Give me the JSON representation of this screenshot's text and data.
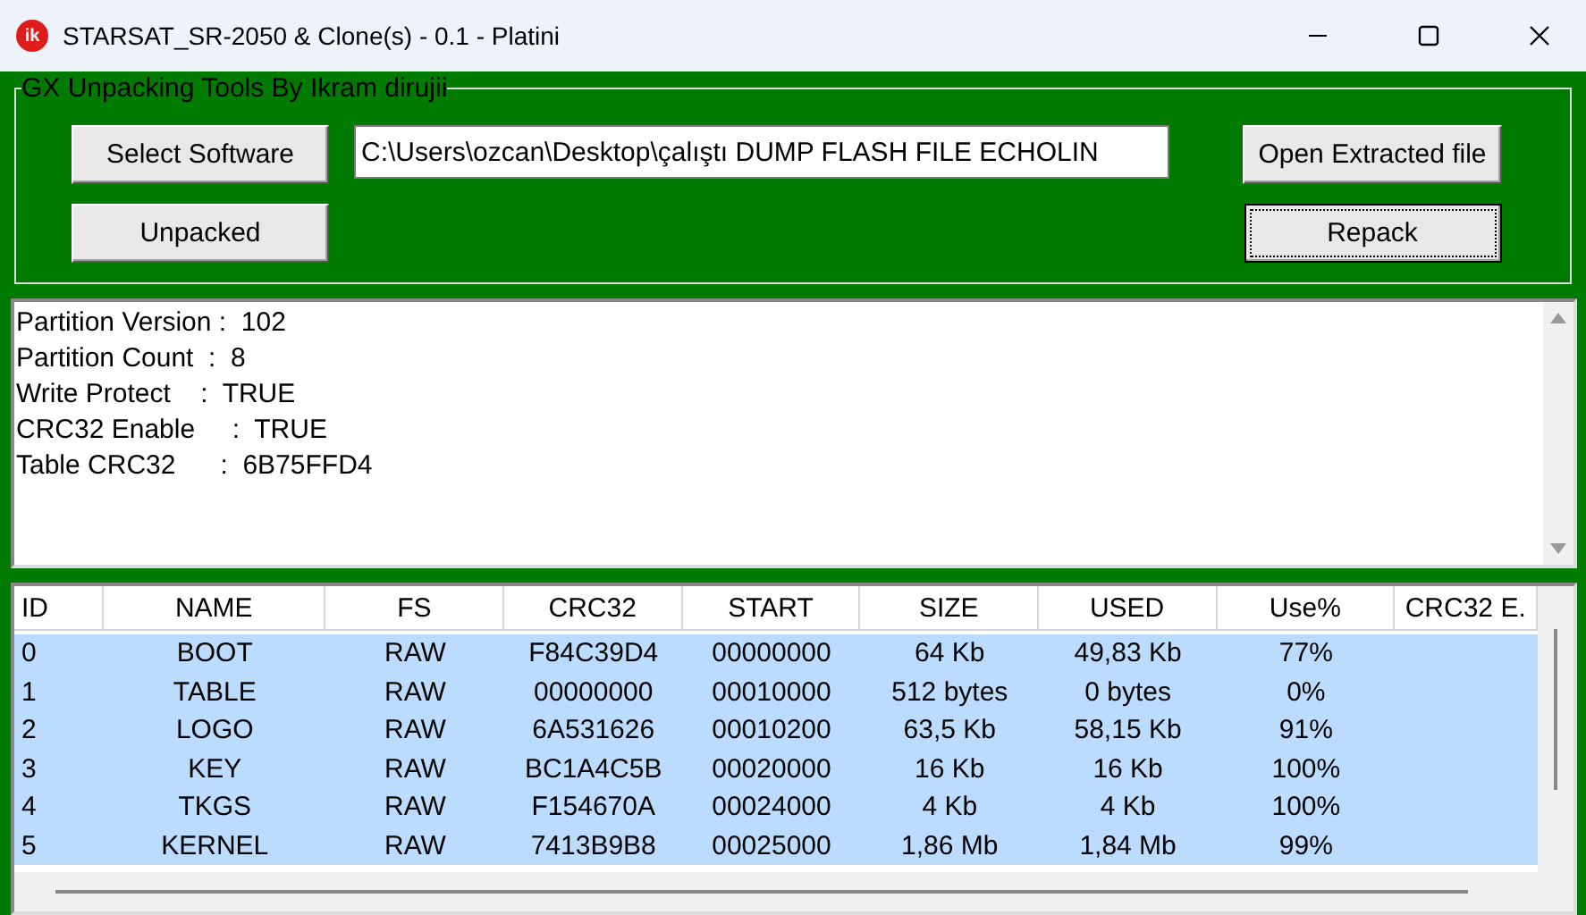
{
  "window": {
    "title": "STARSAT_SR-2050 & Clone(s) - 0.1 - Platini",
    "icon_text": "ik"
  },
  "group": {
    "title": "GX Unpacking Tools By Ikram dirujii"
  },
  "buttons": [
    {
      "label": "Select Software",
      "focused": false
    },
    {
      "label": "Unpacked",
      "focused": false
    },
    {
      "label": "Open Extracted file",
      "focused": false
    },
    {
      "label": "Repack",
      "focused": true
    }
  ],
  "path_field": {
    "value": "C:\\Users\\ozcan\\Desktop\\çalıştı DUMP FLASH FILE ECHOLIN"
  },
  "log_lines": [
    "Partition Version :  102",
    "Partition Count  :  8",
    "Write Protect    :  TRUE",
    "CRC32 Enable     :  TRUE",
    "Table CRC32      :  6B75FFD4"
  ],
  "table": {
    "columns": [
      "ID",
      "NAME",
      "FS",
      "CRC32",
      "START",
      "SIZE",
      "USED",
      "Use%",
      "CRC32 E."
    ],
    "rows": [
      {
        "selected": true,
        "cells": [
          "0",
          "BOOT",
          "RAW",
          "F84C39D4",
          "00000000",
          "64 Kb",
          "49,83 Kb",
          "77%"
        ]
      },
      {
        "selected": true,
        "cells": [
          "1",
          "TABLE",
          "RAW",
          "00000000",
          "00010000",
          "512 bytes",
          "0 bytes",
          "0%"
        ]
      },
      {
        "selected": true,
        "cells": [
          "2",
          "LOGO",
          "RAW",
          "6A531626",
          "00010200",
          "63,5 Kb",
          "58,15 Kb",
          "91%"
        ]
      },
      {
        "selected": true,
        "cells": [
          "3",
          "KEY",
          "RAW",
          "BC1A4C5B",
          "00020000",
          "16 Kb",
          "16 Kb",
          "100%"
        ]
      },
      {
        "selected": true,
        "cells": [
          "4",
          "TKGS",
          "RAW",
          "F154670A",
          "00024000",
          "4 Kb",
          "4 Kb",
          "100%"
        ]
      },
      {
        "selected": true,
        "cells": [
          "5",
          "KERNEL",
          "RAW",
          "7413B9B8",
          "00025000",
          "1,86 Mb",
          "1,84 Mb",
          "99%"
        ]
      }
    ]
  }
}
